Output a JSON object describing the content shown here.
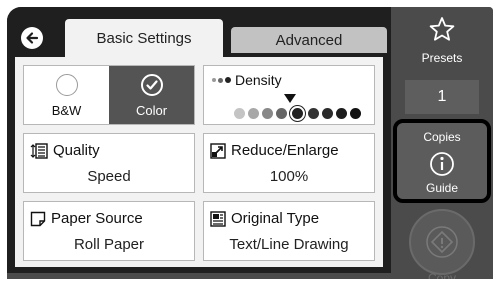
{
  "tabs": {
    "basic": "Basic Settings",
    "advanced": "Advanced"
  },
  "color_mode": {
    "bw_label": "B&W",
    "color_label": "Color",
    "selected": "Color"
  },
  "density": {
    "label": "Density",
    "level_index": 4,
    "steps": 9
  },
  "quality": {
    "label": "Quality",
    "value": "Speed"
  },
  "reduce": {
    "label": "Reduce/Enlarge",
    "value": "100%"
  },
  "paper_source": {
    "label": "Paper Source",
    "value": "Roll Paper"
  },
  "original_type": {
    "label": "Original Type",
    "value": "Text/Line Drawing"
  },
  "side": {
    "presets_label": "Presets",
    "copies_count": "1",
    "copies_label": "Copies",
    "guide_label": "Guide",
    "copy_label": "Copy"
  },
  "colors": {
    "highlight_border": "#000000",
    "selected_bg": "#545454"
  }
}
